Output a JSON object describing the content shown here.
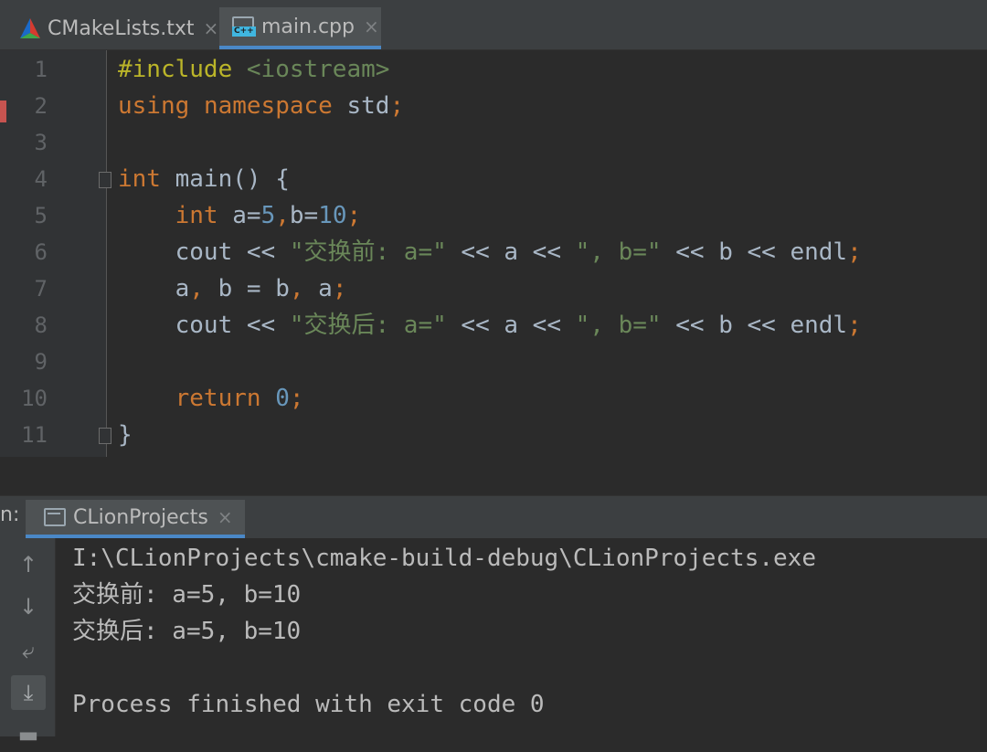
{
  "tabs": [
    {
      "label": "CMakeLists.txt",
      "icon": "cmake-icon",
      "active": false
    },
    {
      "label": "main.cpp",
      "icon": "cpp-file-icon",
      "badge": "C++",
      "active": true
    }
  ],
  "tab_close": "×",
  "editor": {
    "line_numbers": [
      "1",
      "2",
      "3",
      "4",
      "5",
      "6",
      "7",
      "8",
      "9",
      "10",
      "11"
    ],
    "lines": [
      [
        {
          "t": "#include",
          "c": "pp"
        },
        {
          "t": " ",
          "c": "plain"
        },
        {
          "t": "<iostream>",
          "c": "inc"
        }
      ],
      [
        {
          "t": "using",
          "c": "kw"
        },
        {
          "t": " ",
          "c": "plain"
        },
        {
          "t": "namespace",
          "c": "kw"
        },
        {
          "t": " std",
          "c": "plain"
        },
        {
          "t": ";",
          "c": "kw"
        }
      ],
      [],
      [
        {
          "t": "int",
          "c": "kw"
        },
        {
          "t": " main() {",
          "c": "plain"
        }
      ],
      [
        {
          "t": "    ",
          "c": "plain"
        },
        {
          "t": "int",
          "c": "kw"
        },
        {
          "t": " a=",
          "c": "plain"
        },
        {
          "t": "5",
          "c": "num"
        },
        {
          "t": ",",
          "c": "kw"
        },
        {
          "t": "b=",
          "c": "plain"
        },
        {
          "t": "10",
          "c": "num"
        },
        {
          "t": ";",
          "c": "kw"
        }
      ],
      [
        {
          "t": "    cout << ",
          "c": "plain"
        },
        {
          "t": "\"交换前: a=\"",
          "c": "str"
        },
        {
          "t": " << a << ",
          "c": "plain"
        },
        {
          "t": "\", b=\"",
          "c": "str"
        },
        {
          "t": " << b << endl",
          "c": "plain"
        },
        {
          "t": ";",
          "c": "kw"
        }
      ],
      [
        {
          "t": "    a",
          "c": "plain"
        },
        {
          "t": ",",
          "c": "kw"
        },
        {
          "t": " b = b",
          "c": "plain"
        },
        {
          "t": ",",
          "c": "kw"
        },
        {
          "t": " a",
          "c": "plain"
        },
        {
          "t": ";",
          "c": "kw"
        }
      ],
      [
        {
          "t": "    cout << ",
          "c": "plain"
        },
        {
          "t": "\"交换后: a=\"",
          "c": "str"
        },
        {
          "t": " << a << ",
          "c": "plain"
        },
        {
          "t": "\", b=\"",
          "c": "str"
        },
        {
          "t": " << b << endl",
          "c": "plain"
        },
        {
          "t": ";",
          "c": "kw"
        }
      ],
      [],
      [
        {
          "t": "    ",
          "c": "plain"
        },
        {
          "t": "return",
          "c": "kw"
        },
        {
          "t": " ",
          "c": "plain"
        },
        {
          "t": "0",
          "c": "num"
        },
        {
          "t": ";",
          "c": "kw"
        }
      ],
      [
        {
          "t": "}",
          "c": "plain"
        }
      ]
    ]
  },
  "run_panel": {
    "label": "n:",
    "tab_label": "CLionProjects",
    "tools": [
      {
        "icon": "arrow-up-icon",
        "glyph": "↑"
      },
      {
        "icon": "arrow-down-icon",
        "glyph": "↓"
      },
      {
        "icon": "soft-wrap-icon",
        "glyph": "⤶"
      },
      {
        "icon": "scroll-to-end-icon",
        "glyph": "⤓"
      },
      {
        "icon": "print-icon",
        "glyph": "▬"
      }
    ],
    "output": [
      "I:\\CLionProjects\\cmake-build-debug\\CLionProjects.exe",
      "交换前: a=5, b=10",
      "交换后: a=5, b=10",
      "",
      "Process finished with exit code 0"
    ]
  },
  "colors": {
    "keyword": "#cc7832",
    "string": "#6a8759",
    "number": "#6897bb",
    "preprocessor": "#bbb529",
    "text": "#a9b7c6",
    "accent": "#4a88c7",
    "bookmark": "#c75450"
  }
}
